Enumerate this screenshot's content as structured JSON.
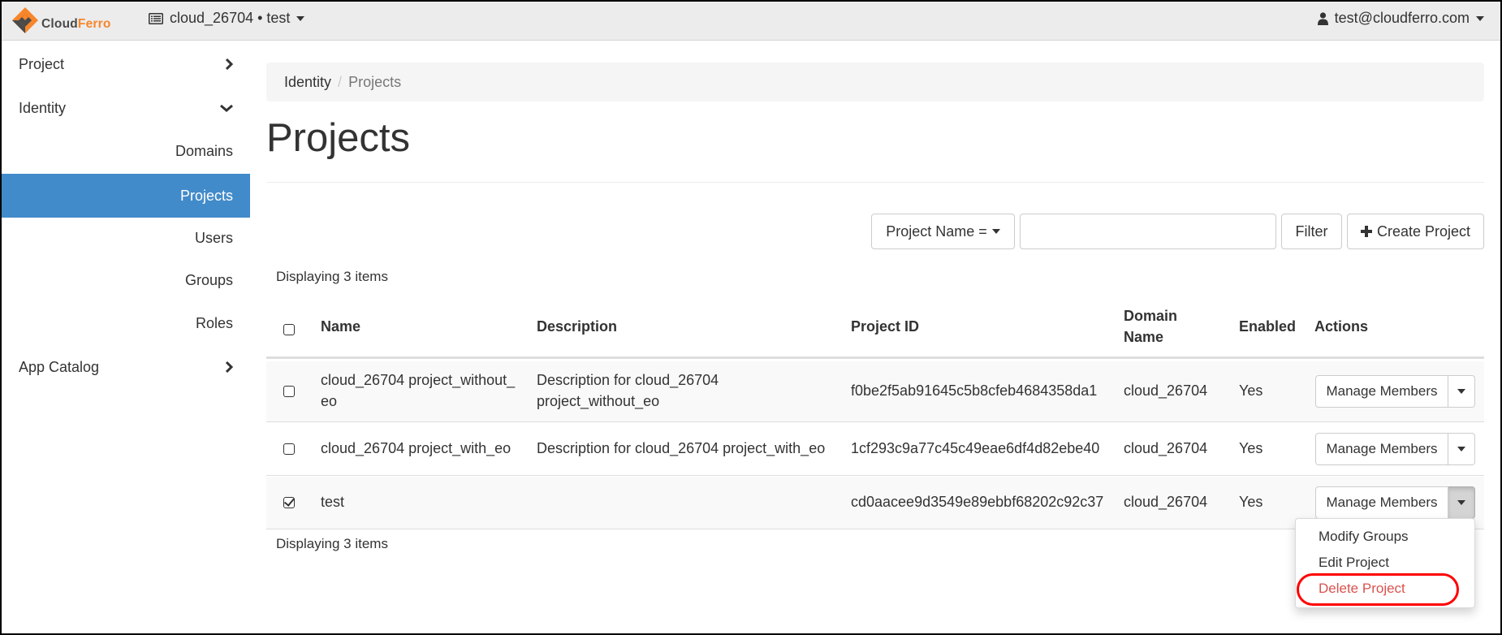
{
  "topbar": {
    "logo": {
      "part1": "Cloud",
      "part2": "Ferro",
      "brand_orange": "#f7862a",
      "brand_gray": "#4a4a4a"
    },
    "context": {
      "icon": "server-list-icon",
      "label": "cloud_26704 • test"
    },
    "user": {
      "icon": "user-icon",
      "label": "test@cloudferro.com"
    }
  },
  "sidebar": {
    "sections": [
      {
        "label": "Project",
        "icon": "chevron-right-icon",
        "expanded": false
      },
      {
        "label": "Identity",
        "icon": "chevron-down-icon",
        "expanded": true
      },
      {
        "label": "App Catalog",
        "icon": "chevron-right-icon",
        "expanded": false
      }
    ],
    "identity_items": [
      {
        "label": "Domains",
        "active": false
      },
      {
        "label": "Projects",
        "active": true
      },
      {
        "label": "Users",
        "active": false
      },
      {
        "label": "Groups",
        "active": false
      },
      {
        "label": "Roles",
        "active": false
      }
    ],
    "active_color": "#428bca"
  },
  "breadcrumb": {
    "parent": "Identity",
    "separator": "/",
    "current": "Projects"
  },
  "page_title": "Projects",
  "toolbar": {
    "filter_field": "Project Name =",
    "filter_value": "",
    "filter_button": "Filter",
    "create_button": "Create Project",
    "create_icon": "plus-icon"
  },
  "table": {
    "count_top": "Displaying 3 items",
    "count_bottom": "Displaying 3 items",
    "columns": {
      "name": "Name",
      "description": "Description",
      "project_id": "Project ID",
      "domain_name_line1": "Domain",
      "domain_name_line2": "Name",
      "enabled": "Enabled",
      "actions": "Actions"
    },
    "rows": [
      {
        "checked": false,
        "name_line1": "cloud_26704 project_without_",
        "name_line2": "eo",
        "description_line1": "Description for cloud_26704",
        "description_line2": "project_without_eo",
        "project_id": "f0be2f5ab91645c5b8cfeb4684358da1",
        "domain": "cloud_26704",
        "enabled": "Yes",
        "action": "Manage Members"
      },
      {
        "checked": false,
        "name_line1": "cloud_26704 project_with_eo",
        "description_line1": "Description for cloud_26704 project_with_eo",
        "project_id": "1cf293c9a77c45c49eae6df4d82ebe40",
        "domain": "cloud_26704",
        "enabled": "Yes",
        "action": "Manage Members"
      },
      {
        "checked": true,
        "name_line1": "test",
        "description_line1": "",
        "project_id": "cd0aacee9d3549e89ebbf68202c92c37",
        "domain": "cloud_26704",
        "enabled": "Yes",
        "action": "Manage Members"
      }
    ]
  },
  "dropdown_menu": {
    "items": [
      {
        "label": "Modify Groups",
        "danger": false
      },
      {
        "label": "Edit Project",
        "danger": false
      },
      {
        "label": "Delete Project",
        "danger": true,
        "highlighted": true
      }
    ],
    "danger_color": "#d9534f",
    "highlight_color": "#ff0000"
  }
}
